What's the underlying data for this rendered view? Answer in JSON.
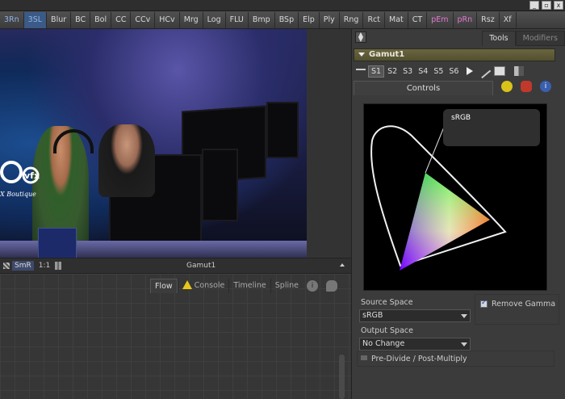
{
  "toolbar": {
    "buttons": [
      {
        "label": "3Rn",
        "style": "blue"
      },
      {
        "label": "3SL",
        "style": "blue"
      },
      {
        "label": "Blur",
        "style": ""
      },
      {
        "label": "BC",
        "style": ""
      },
      {
        "label": "Bol",
        "style": ""
      },
      {
        "label": "CC",
        "style": ""
      },
      {
        "label": "CCv",
        "style": ""
      },
      {
        "label": "HCv",
        "style": ""
      },
      {
        "label": "Mrg",
        "style": ""
      },
      {
        "label": "Log",
        "style": ""
      },
      {
        "label": "FLU",
        "style": ""
      },
      {
        "label": "Bmp",
        "style": ""
      },
      {
        "label": "BSp",
        "style": ""
      },
      {
        "label": "Elp",
        "style": ""
      },
      {
        "label": "Ply",
        "style": ""
      },
      {
        "label": "Rng",
        "style": ""
      },
      {
        "label": "Rct",
        "style": ""
      },
      {
        "label": "Mat",
        "style": ""
      },
      {
        "label": "CT",
        "style": ""
      },
      {
        "label": "pEm",
        "style": "pink"
      },
      {
        "label": "pRn",
        "style": "pink"
      },
      {
        "label": "Rsz",
        "style": ""
      },
      {
        "label": "Xf",
        "style": ""
      }
    ]
  },
  "window": {
    "minimize": "_",
    "restore": "▫",
    "close": "x"
  },
  "viewer": {
    "logo_text": "CVFX",
    "logo_sub": "FX Boutique",
    "footer": {
      "smr": "SmR",
      "ratio": "1:1",
      "title": "Gamut1"
    }
  },
  "flow_tabs": [
    "Flow",
    "Console",
    "Timeline",
    "Spline"
  ],
  "right_panel": {
    "tabs": [
      "Tools",
      "Modifiers"
    ],
    "tool_name": "Gamut1",
    "states": [
      "S1",
      "S2",
      "S3",
      "S4",
      "S5",
      "S6"
    ],
    "controls_tab": "Controls",
    "graph_label": "sRGB",
    "source_space": {
      "label": "Source Space",
      "value": "sRGB"
    },
    "remove_gamma": {
      "label": "Remove Gamma",
      "checked": true
    },
    "output_space": {
      "label": "Output Space",
      "value": "No Change"
    },
    "pre_divide": {
      "label": "Pre-Divide / Post-Multiply",
      "checked": false
    }
  }
}
